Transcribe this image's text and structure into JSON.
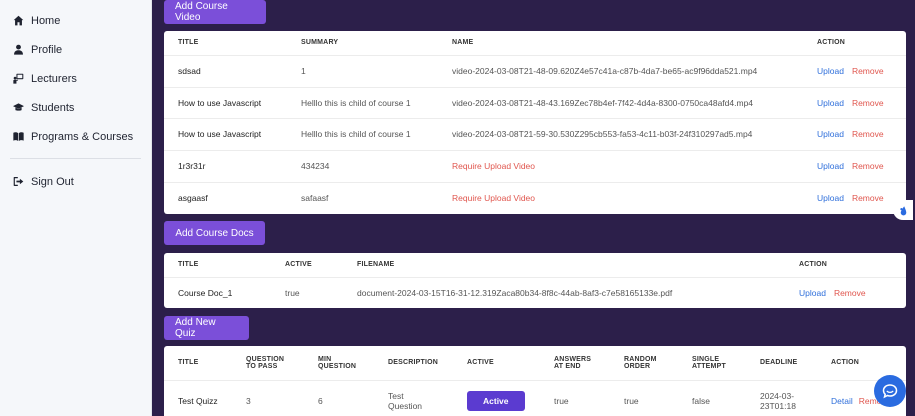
{
  "sidebar": {
    "items": [
      {
        "label": "Home",
        "icon": "home-icon"
      },
      {
        "label": "Profile",
        "icon": "user-icon"
      },
      {
        "label": "Lecturers",
        "icon": "lecturer-icon"
      },
      {
        "label": "Students",
        "icon": "graduation-cap-icon"
      },
      {
        "label": "Programs & Courses",
        "icon": "book-icon"
      }
    ],
    "signout": {
      "label": "Sign Out",
      "icon": "sign-out-icon"
    }
  },
  "videos": {
    "button_label": "Add Course Video",
    "headers": [
      "TITLE",
      "SUMMARY",
      "NAME",
      "ACTION"
    ],
    "rows": [
      {
        "title": "sdsad",
        "summary": "1",
        "name": "video-2024-03-08T21-48-09.620Z4e57c41a-c87b-4da7-be65-ac9f96dda521.mp4",
        "missing": false
      },
      {
        "title": "How to use Javascript",
        "summary": "Helllo this is child of course 1",
        "name": "video-2024-03-08T21-48-43.169Zec78b4ef-7f42-4d4a-8300-0750ca48afd4.mp4",
        "missing": false
      },
      {
        "title": "How to use Javascript",
        "summary": "Helllo this is child of course 1",
        "name": "video-2024-03-08T21-59-30.530Z295cb553-fa53-4c11-b03f-24f310297ad5.mp4",
        "missing": false
      },
      {
        "title": "1r3r31r",
        "summary": "434234",
        "name": "Require Upload Video",
        "missing": true
      },
      {
        "title": "asgaasf",
        "summary": "safaasf",
        "name": "Require Upload Video",
        "missing": true
      }
    ],
    "upload_label": "Upload",
    "remove_label": "Remove"
  },
  "docs": {
    "button_label": "Add Course Docs",
    "headers": [
      "TITLE",
      "ACTIVE",
      "FILENAME",
      "ACTION"
    ],
    "rows": [
      {
        "title": "Course Doc_1",
        "active": "true",
        "filename": "document-2024-03-15T16-31-12.319Zaca80b34-8f8c-44ab-8af3-c7e58165133e.pdf"
      }
    ],
    "upload_label": "Upload",
    "remove_label": "Remove"
  },
  "quiz": {
    "button_label": "Add New Quiz",
    "headers": {
      "title": "TITLE",
      "question_to_pass_1": "QUESTION",
      "question_to_pass_2": "TO PASS",
      "min_question_1": "MIN",
      "min_question_2": "QUESTION",
      "description": "DESCRIPTION",
      "active": "ACTIVE",
      "answers_at_end_1": "ANSWERS",
      "answers_at_end_2": "AT END",
      "random_order_1": "RANDOM",
      "random_order_2": "ORDER",
      "single_attempt_1": "SINGLE",
      "single_attempt_2": "ATTEMPT",
      "deadline": "DEADLINE",
      "action": "ACTION"
    },
    "rows": [
      {
        "title": "Test Quizz",
        "question_to_pass": "3",
        "min_question": "6",
        "description_1": "Test",
        "description_2": "Question",
        "active": "Active",
        "answers_at_end": "true",
        "random_order": "true",
        "single_attempt": "false",
        "deadline_1": "2024-03-",
        "deadline_2": "23T01:18",
        "detail_label": "Detail",
        "remove_label": "Remove"
      }
    ]
  },
  "colors": {
    "background": "#2c1f4a",
    "accent": "#7b4fd9",
    "link": "#2f6fdb",
    "danger": "#e0564e",
    "chat": "#2a6be0"
  }
}
